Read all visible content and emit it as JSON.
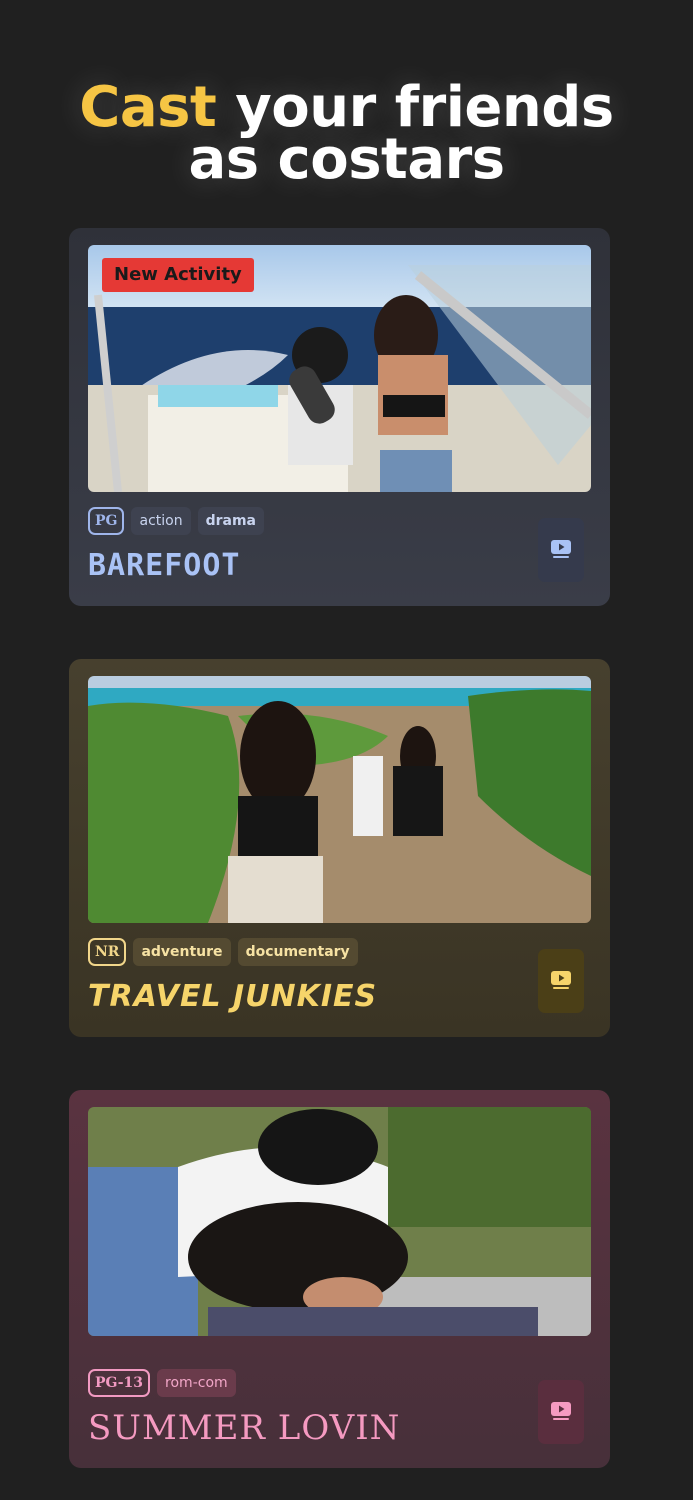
{
  "headline": {
    "accent": "Cast",
    "line1_rest": "your friends",
    "line2": "as costars"
  },
  "colors": {
    "accent": "#f6c544",
    "background": "#202020"
  },
  "cards": [
    {
      "badge": "New Activity",
      "rating": "PG",
      "genres": [
        "action",
        "drama"
      ],
      "title": "BAREFOOT",
      "play_icon": "play-icon",
      "accent_color": "#a9c2f5"
    },
    {
      "rating": "NR",
      "genres": [
        "adventure",
        "documentary"
      ],
      "title": "TRAVEL JUNKIES",
      "play_icon": "play-icon",
      "accent_color": "#f6d46a"
    },
    {
      "rating": "PG-13",
      "genres": [
        "rom-com"
      ],
      "title": "SUMMER LOVIN",
      "play_icon": "play-icon",
      "accent_color": "#f59ac1"
    }
  ]
}
